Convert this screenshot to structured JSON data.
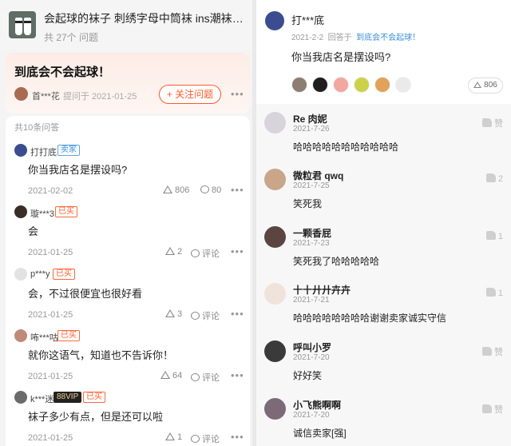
{
  "left": {
    "product": {
      "title": "会起球的袜子 刺绣字母中筒袜 ins潮袜男...",
      "count": "共 27个 问题"
    },
    "question": {
      "title": "到底会不会起球！",
      "asker": "首***花",
      "asked_at": "提问于 2021-01-25",
      "follow_label": "+ 关注问题"
    },
    "answer_count": "共10条问答",
    "answers": [
      {
        "name": "打打底",
        "tag": "卖家",
        "text": "你当我店名是摆设吗?",
        "date": "2021-02-02",
        "likes": "806",
        "comments": "80"
      },
      {
        "name": "璇***3",
        "tag": "已买",
        "text": "会",
        "date": "2021-01-25",
        "likes": "2",
        "comments": "评论"
      },
      {
        "name": "p***y",
        "tag": "已买",
        "text": "会，不过很便宜也很好看",
        "date": "2021-01-25",
        "likes": "3",
        "comments": "评论"
      },
      {
        "name": "咘***咕",
        "tag": "已买",
        "text": "就你这语气，知道也不告诉你！",
        "date": "2021-01-25",
        "likes": "64",
        "comments": "评论"
      },
      {
        "name": "k***迷",
        "tag": "已买",
        "vip": "88VIP",
        "text": "袜子多少有点，但是还可以啦",
        "date": "2021-01-25",
        "likes": "1",
        "comments": "评论"
      }
    ]
  },
  "right": {
    "answer": {
      "name": "打***底",
      "date": "2021-2-2",
      "replied_to_prefix": "回答于",
      "replied_to": "到底会不会起球！",
      "text": "你当我店名是摆设吗?",
      "likes": "806"
    },
    "comments": [
      {
        "name": "Re 肉妮",
        "date": "2021-7-26",
        "text": "哈哈哈哈哈哈哈哈哈哈哈",
        "like": "赞"
      },
      {
        "name": "微粒君 qwq",
        "date": "2021-7-25",
        "text": "笑死我",
        "like": "2"
      },
      {
        "name": "一颗香屁",
        "date": "2021-7-23",
        "text": "笑死我了哈哈哈哈哈",
        "like": "1"
      },
      {
        "name": "十十廾廾卉卉",
        "date": "2021-7-21",
        "text": "哈哈哈哈哈哈哈哈谢谢卖家诚实守信",
        "like": "1"
      },
      {
        "name": "呼叫小罗",
        "date": "2021-7-20",
        "text": "好好笑",
        "like": "赞"
      },
      {
        "name": "小飞熊啊啊",
        "date": "2021-7-20",
        "text": "诚信卖家[强]",
        "like": "赞"
      }
    ]
  },
  "colors": {
    "accent": "#ff5a2a",
    "link": "#3b8fd6"
  }
}
